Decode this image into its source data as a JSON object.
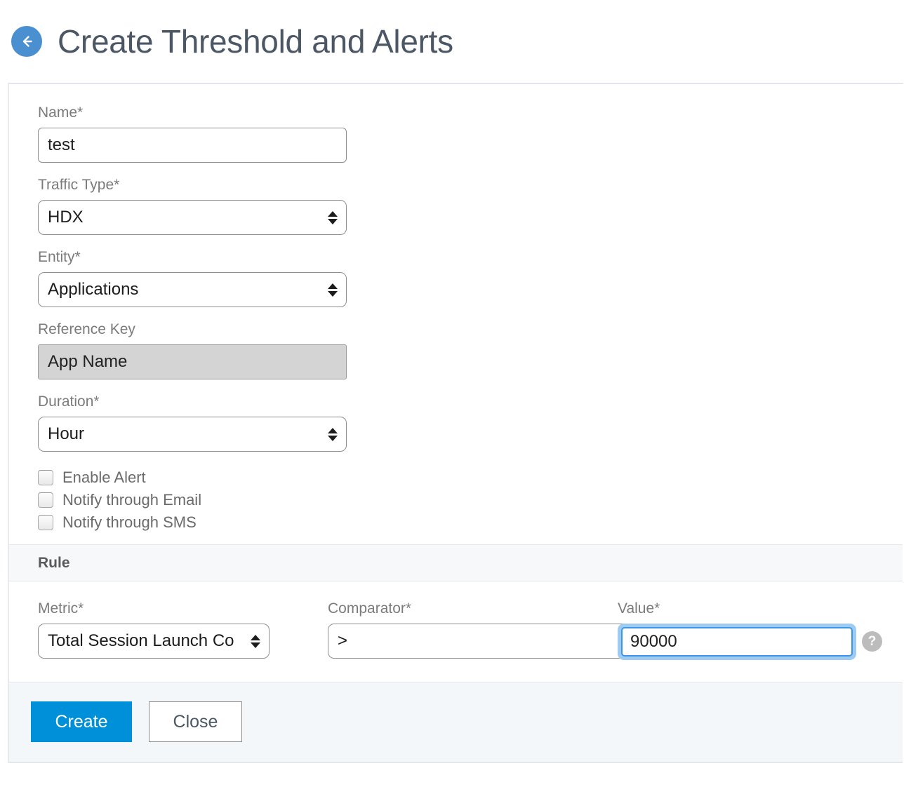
{
  "header": {
    "back_icon": "arrow-left-circle-icon",
    "title": "Create Threshold and Alerts"
  },
  "form": {
    "name": {
      "label": "Name*",
      "value": "test",
      "placeholder": ""
    },
    "traffic_type": {
      "label": "Traffic Type*",
      "value": "HDX"
    },
    "entity": {
      "label": "Entity*",
      "value": "Applications"
    },
    "reference_key": {
      "label": "Reference Key",
      "value": "App Name",
      "readonly": true
    },
    "duration": {
      "label": "Duration*",
      "value": "Hour"
    },
    "checkboxes": [
      {
        "label": "Enable Alert",
        "checked": false
      },
      {
        "label": "Notify through Email",
        "checked": false
      },
      {
        "label": "Notify through SMS",
        "checked": false
      }
    ]
  },
  "rule": {
    "section_title": "Rule",
    "metric": {
      "label": "Metric*",
      "value": "Total Session Launch Co"
    },
    "comparator": {
      "label": "Comparator*",
      "value": ">"
    },
    "value": {
      "label": "Value*",
      "value": "90000",
      "help_icon": "question-mark-circle-icon"
    }
  },
  "footer": {
    "create_label": "Create",
    "close_label": "Close"
  },
  "colors": {
    "primary_button": "#008fd9",
    "back_icon": "#4a8fd0",
    "focus_ring": "#3b96e8",
    "label_text": "#7b7b7b",
    "title_text": "#4c5765",
    "rule_band_bg": "#f7f8f9",
    "footer_bg": "#f3f7fa",
    "readonly_bg": "#d4d4d4",
    "help_icon": "#bcbcbc"
  }
}
